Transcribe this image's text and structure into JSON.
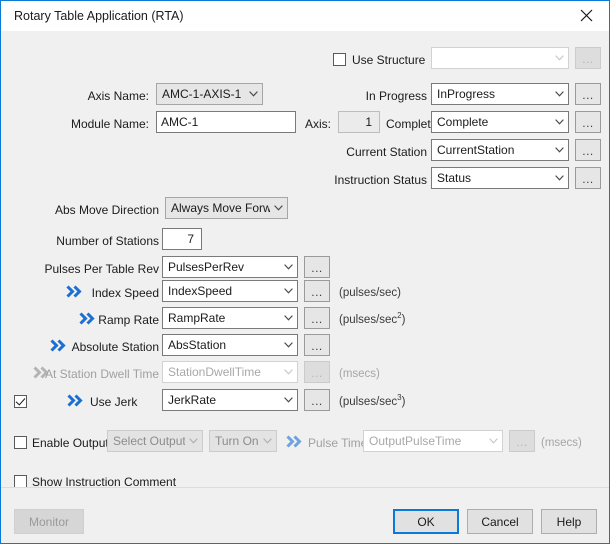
{
  "window": {
    "title": "Rotary Table Application (RTA)",
    "close_icon": "close-icon",
    "accent_color": "#0a7ad6"
  },
  "structure": {
    "checkbox_label": "Use Structure",
    "checked": false,
    "combo_value": "",
    "browse_label": "...",
    "enabled": false
  },
  "left": {
    "axis_name_label": "Axis Name:",
    "axis_name_value": "AMC-1-AXIS-1",
    "module_name_label": "Module Name:",
    "module_name_value": "AMC-1",
    "abs_move_direction_label": "Abs Move Direction",
    "abs_move_direction_value": "Always Move Forward",
    "number_of_stations_label": "Number of Stations",
    "number_of_stations_value": "7",
    "pulses_per_table_rev_label": "Pulses Per Table Rev",
    "pulses_per_table_rev_value": "PulsesPerRev"
  },
  "right": {
    "in_progress_label": "In Progress",
    "in_progress_value": "InProgress",
    "axis_label": "Axis:",
    "axis_value": "1",
    "complete_label": "Complete",
    "complete_value": "Complete",
    "current_station_label": "Current Station",
    "current_station_value": "CurrentStation",
    "instruction_status_label": "Instruction Status",
    "instruction_status_value": "Status"
  },
  "params": [
    {
      "name": "index-speed",
      "label": "Index Speed",
      "value": "IndexSpeed",
      "units": "(pulses/sec)",
      "units_sup": "",
      "enabled": true,
      "chevron": true
    },
    {
      "name": "ramp-rate",
      "label": "Ramp Rate",
      "value": "RampRate",
      "units": "(pulses/sec",
      "units_sup": "2",
      "enabled": true,
      "chevron": true
    },
    {
      "name": "absolute-station",
      "label": "Absolute Station",
      "value": "AbsStation",
      "units": "",
      "units_sup": "",
      "enabled": true,
      "chevron": true
    },
    {
      "name": "at-station-dwell-time",
      "label": "At Station Dwell Time",
      "value": "StationDwellTime",
      "units": "(msecs)",
      "units_sup": "",
      "enabled": false,
      "chevron": true
    },
    {
      "name": "use-jerk",
      "label": "Use Jerk",
      "value": "JerkRate",
      "units": "(pulses/sec",
      "units_sup": "3",
      "enabled": true,
      "chevron": true
    }
  ],
  "use_jerk": {
    "checked": true
  },
  "output": {
    "enable_output_label": "Enable Output",
    "enable_output_checked": false,
    "select_output_value": "Select Output",
    "turn_on_value": "Turn On",
    "pulse_time_label": "Pulse Time",
    "pulse_time_value": "OutputPulseTime",
    "pulse_time_units": "(msecs)",
    "browse_label": "..."
  },
  "comment": {
    "label": "Show Instruction Comment",
    "checked": false
  },
  "buttons": {
    "monitor": "Monitor",
    "ok": "OK",
    "cancel": "Cancel",
    "help": "Help"
  },
  "browse_label": "..."
}
